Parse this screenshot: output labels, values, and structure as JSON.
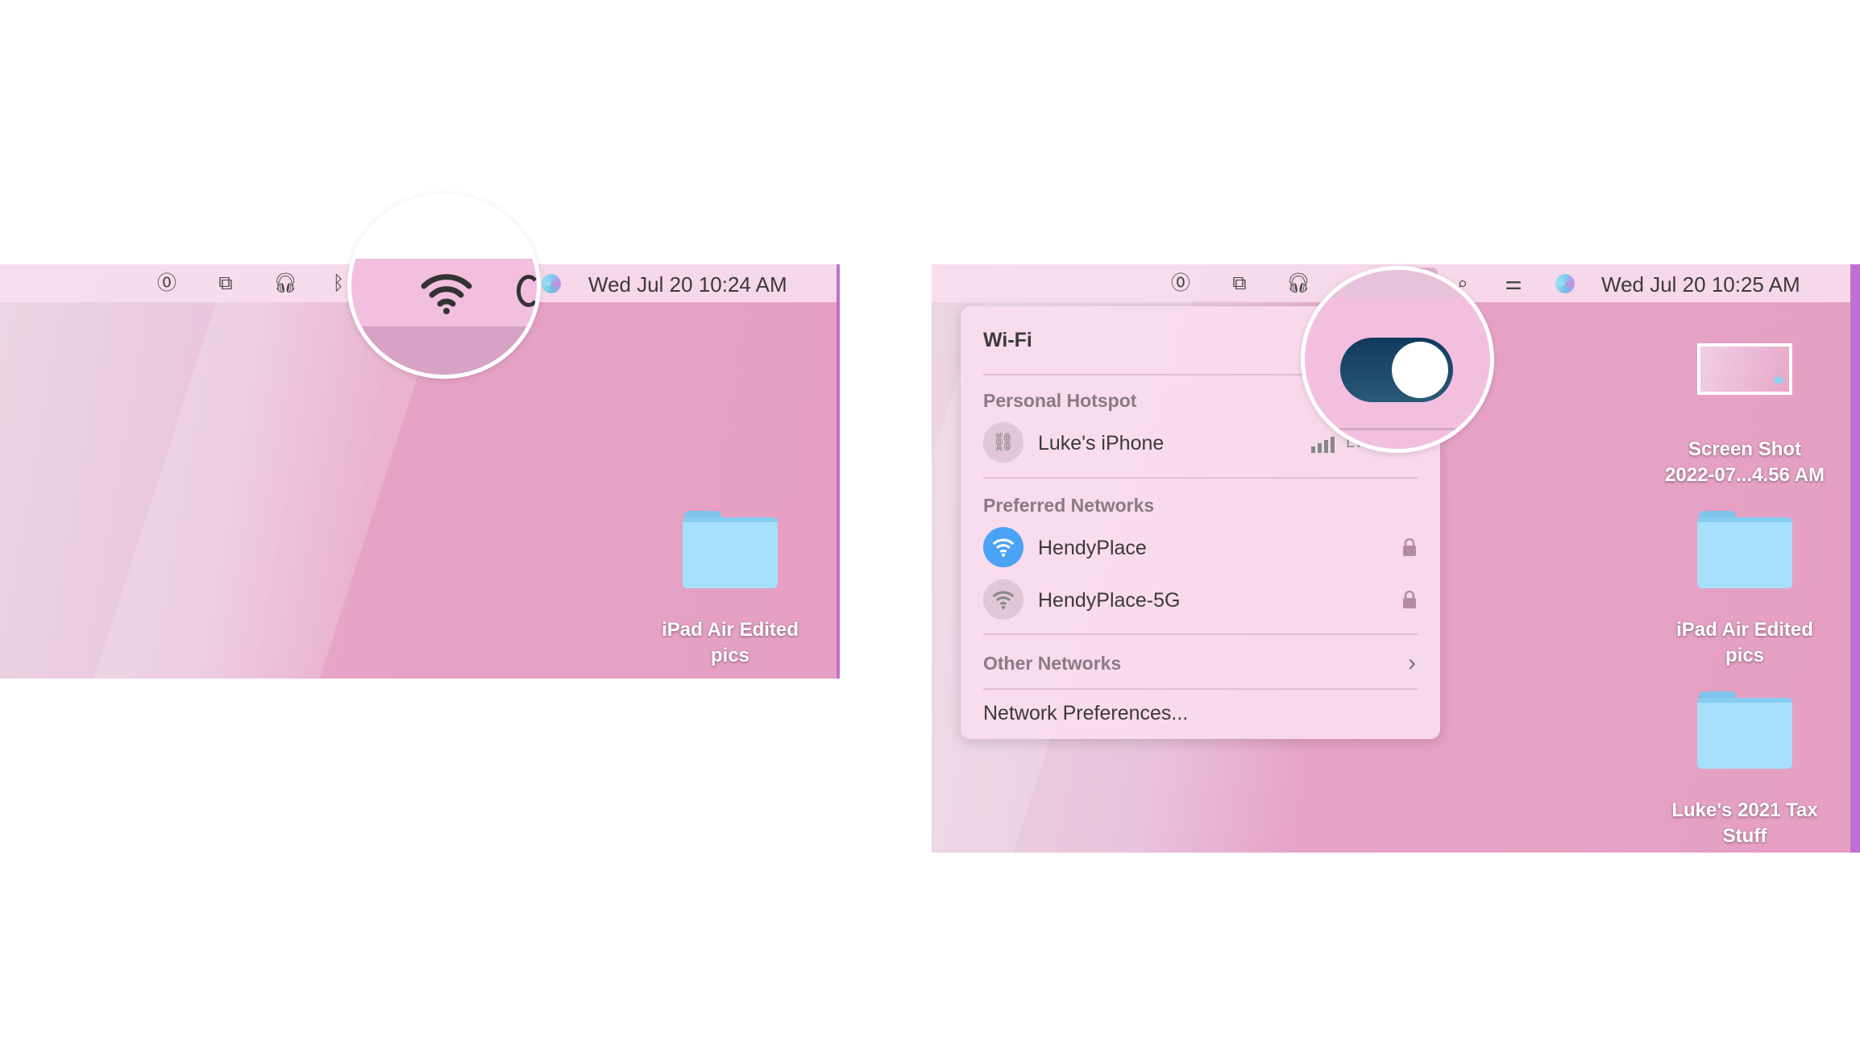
{
  "left_screen": {
    "menubar": {
      "icons": [
        "1password-icon",
        "screen-mirroring-icon",
        "headphones-icon",
        "bluetooth-icon",
        "wifi-icon",
        "siri-icon"
      ],
      "clock": "Wed Jul 20  10:24 AM"
    },
    "desktop_items": [
      {
        "label": "iPad Air Edited pics",
        "type": "folder"
      }
    ]
  },
  "right_screen": {
    "menubar": {
      "icons": [
        "1password-icon",
        "screen-mirroring-icon",
        "headphones-icon",
        "wifi-icon",
        "search-icon",
        "control-center-icon",
        "siri-icon"
      ],
      "clock": "Wed Jul 20  10:25 AM"
    },
    "wifi_menu": {
      "title": "Wi-Fi",
      "toggle_on": true,
      "toggle_color": "#1d4766",
      "personal_hotspot_header": "Personal Hotspot",
      "hotspot": {
        "name": "Luke's iPhone",
        "signal": "LTE"
      },
      "preferred_header": "Preferred Networks",
      "networks": [
        {
          "name": "HendyPlace",
          "connected": true,
          "locked": true
        },
        {
          "name": "HendyPlace-5G",
          "connected": false,
          "locked": true
        }
      ],
      "other_networks": "Other Networks",
      "network_preferences": "Network Preferences..."
    },
    "desktop_items": [
      {
        "label_line1": "Screen Shot",
        "label_line2": "2022-07...4.56 AM",
        "type": "screenshot"
      },
      {
        "label": "iPad Air Edited pics",
        "type": "folder"
      },
      {
        "label": "Luke's 2021 Tax Stuff",
        "type": "folder"
      }
    ]
  },
  "accent_color": "#4aa3f5"
}
